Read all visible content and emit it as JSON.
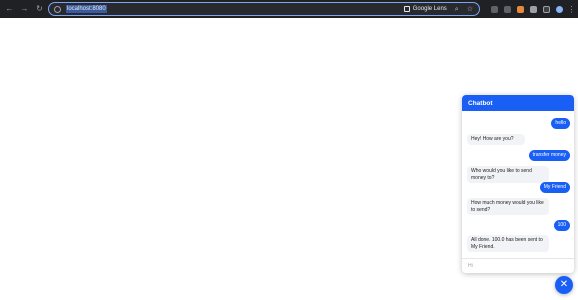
{
  "browser": {
    "url": "localhost:8080",
    "lens_label": "Google Lens",
    "icons": [
      "back-arrow-icon",
      "forward-arrow-icon",
      "reload-icon",
      "site-info-icon",
      "google-lens-icon",
      "zoom-icon",
      "bookmark-star-icon",
      "extensions-icon",
      "profile-icon",
      "menu-icon"
    ]
  },
  "chat": {
    "title": "Chatbot",
    "messages": [
      {
        "from": "user",
        "text": "hello"
      },
      {
        "from": "bot",
        "text": "Hey! How are you?"
      },
      {
        "from": "user",
        "text": "transfer money"
      },
      {
        "from": "bot",
        "text": "Who would you like to send money to?"
      },
      {
        "from": "user",
        "text": "My Friend"
      },
      {
        "from": "bot",
        "text": "How much money would you like to send?"
      },
      {
        "from": "user",
        "text": "100"
      },
      {
        "from": "bot",
        "text": "All done. 100.0 has been sent to My Friend."
      }
    ],
    "input_placeholder": "Hi",
    "close_symbol": "✕"
  },
  "colors": {
    "accent": "#1a5ff5",
    "toolbar_bg": "#202124",
    "bot_bubble": "#f1f3f6"
  }
}
